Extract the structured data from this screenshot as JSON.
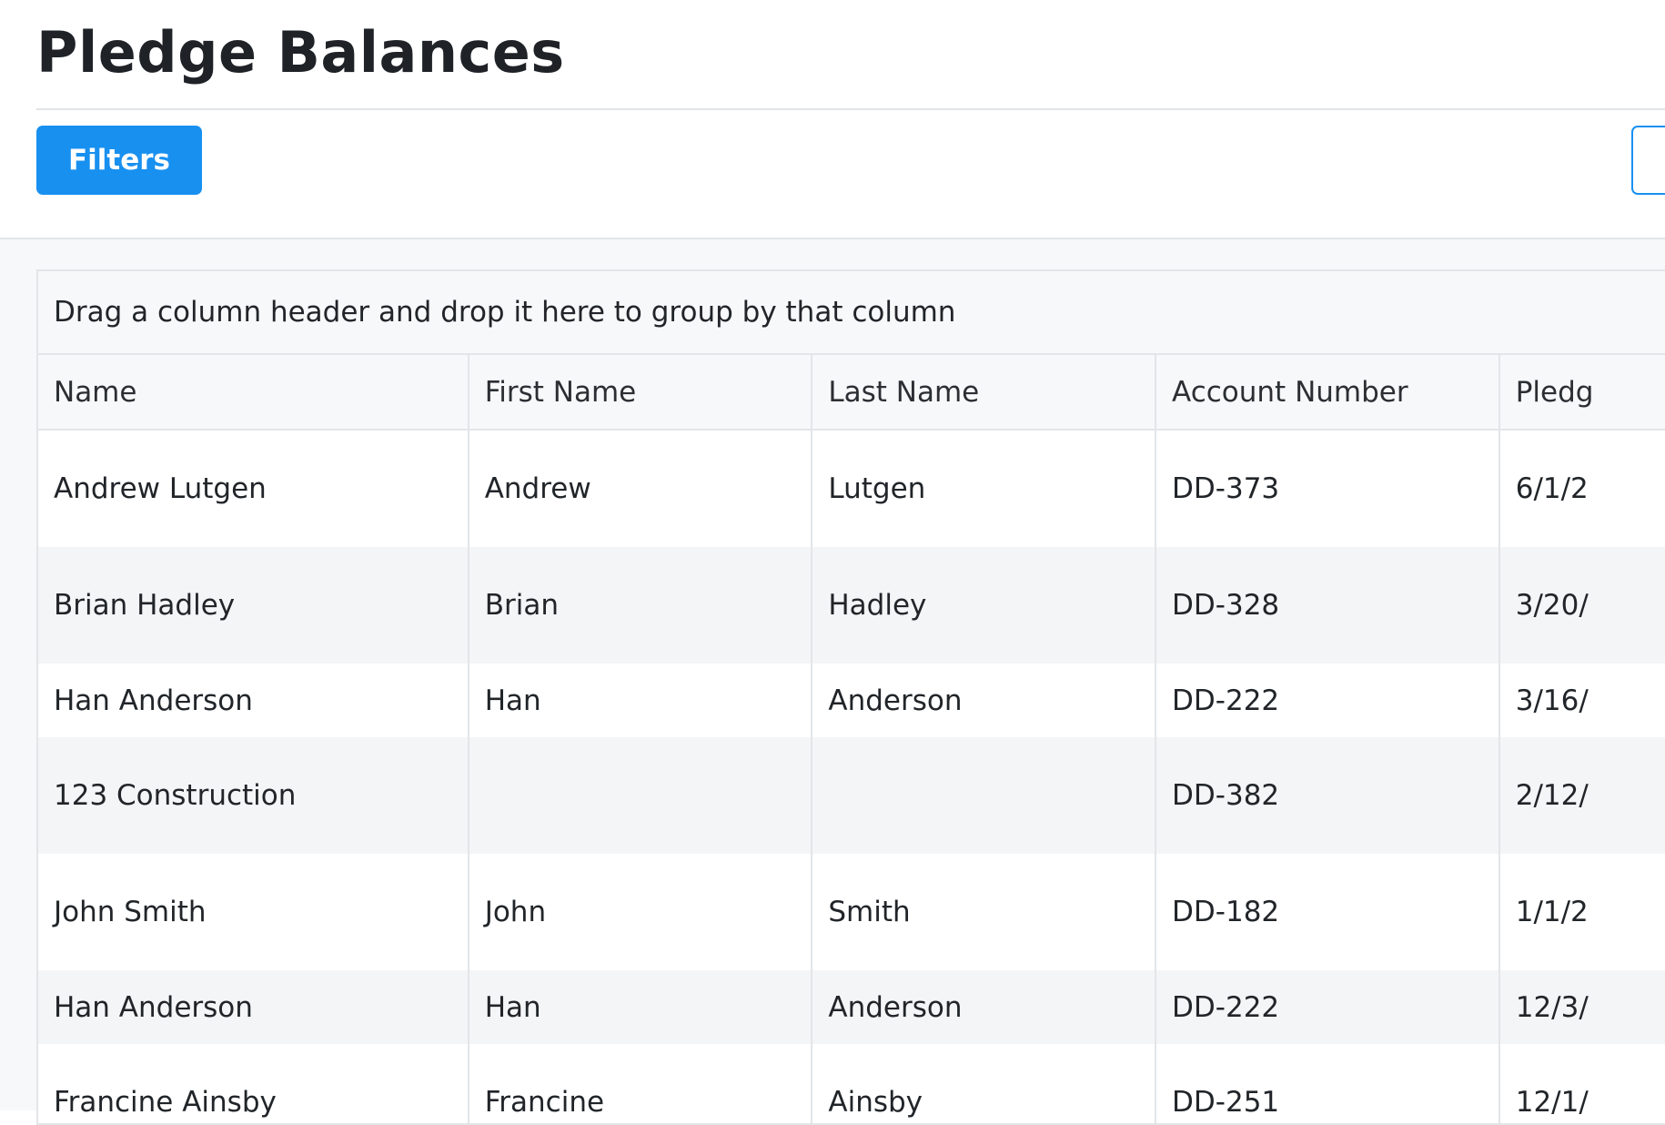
{
  "page": {
    "title": "Pledge Balances"
  },
  "toolbar": {
    "filters_label": "Filters"
  },
  "grid": {
    "group_panel_text": "Drag a column header and drop it here to group by that column",
    "columns": [
      "Name",
      "First Name",
      "Last Name",
      "Account Number",
      "Pledg"
    ],
    "rows": [
      {
        "name": "Andrew Lutgen",
        "first": "Andrew",
        "last": "Lutgen",
        "account": "DD-373",
        "pledge": "6/1/2"
      },
      {
        "name": "Brian Hadley",
        "first": "Brian",
        "last": "Hadley",
        "account": "DD-328",
        "pledge": "3/20/"
      },
      {
        "name": "Han Anderson",
        "first": "Han",
        "last": "Anderson",
        "account": "DD-222",
        "pledge": "3/16/"
      },
      {
        "name": "123 Construction",
        "first": "",
        "last": "",
        "account": "DD-382",
        "pledge": "2/12/"
      },
      {
        "name": "John Smith",
        "first": "John",
        "last": "Smith",
        "account": "DD-182",
        "pledge": "1/1/2"
      },
      {
        "name": "Han Anderson",
        "first": "Han",
        "last": "Anderson",
        "account": "DD-222",
        "pledge": "12/3/"
      },
      {
        "name": "Francine Ainsby",
        "first": "Francine",
        "last": "Ainsby",
        "account": "DD-251",
        "pledge": "12/1/"
      }
    ]
  },
  "colors": {
    "accent": "#1890f0",
    "row_alt": "#f4f5f6",
    "border": "#e3e5e8"
  }
}
